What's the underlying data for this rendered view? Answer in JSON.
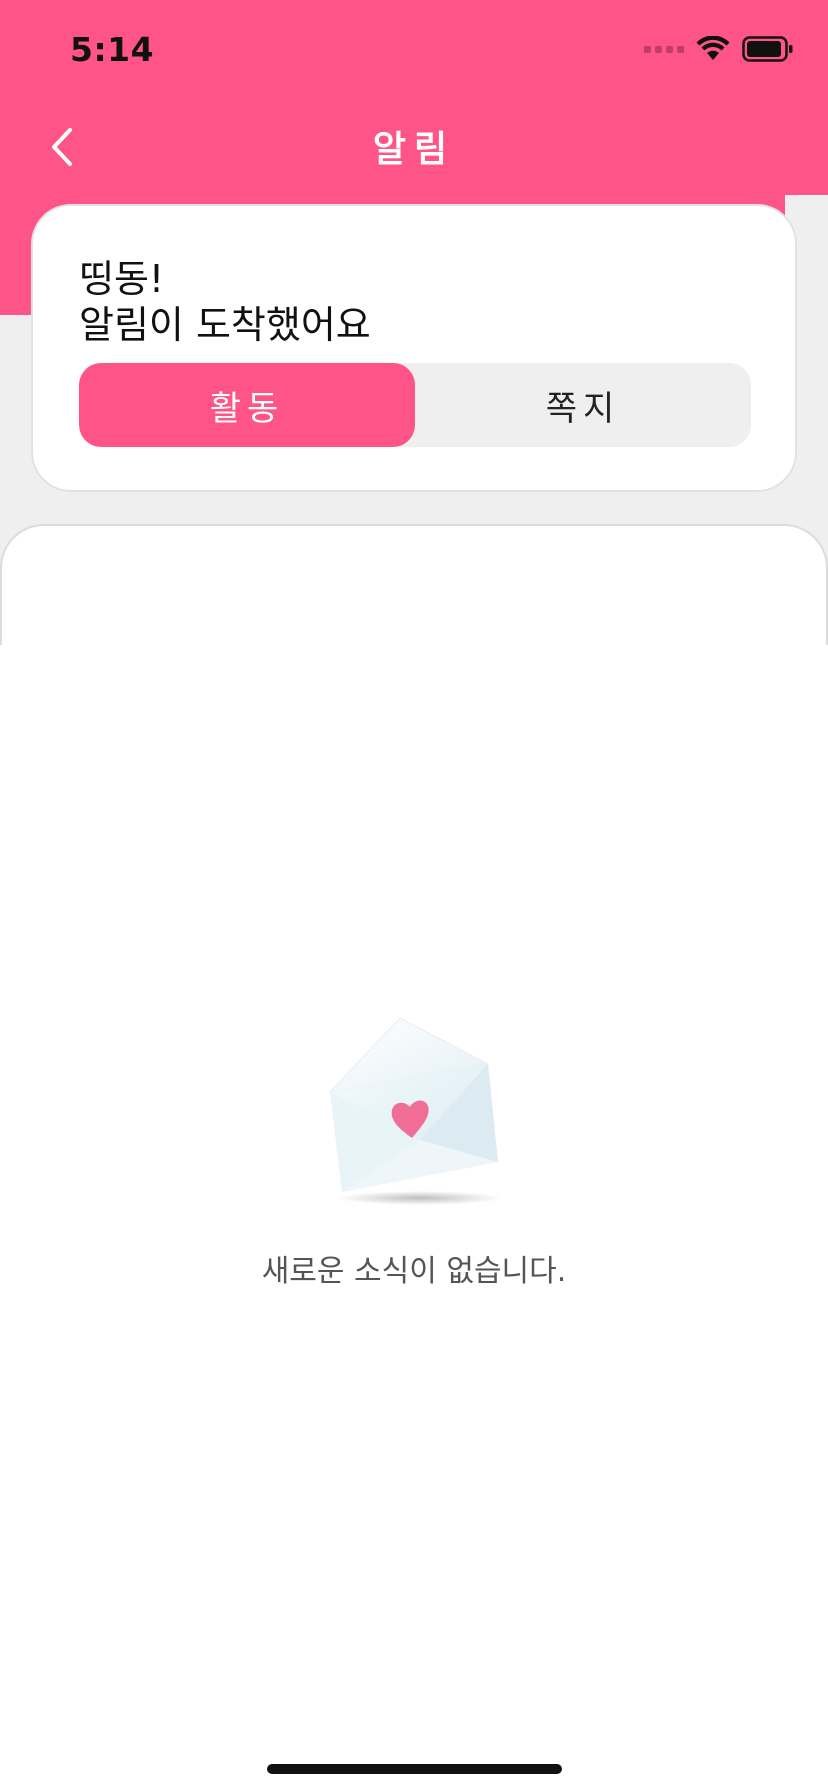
{
  "status_bar": {
    "time": "5:14"
  },
  "nav": {
    "title": "알림",
    "back_icon": "chevron-left-icon"
  },
  "greeting": {
    "line1": "띵동!",
    "line2": "알림이 도착했어요"
  },
  "tabs": [
    {
      "label": "활동",
      "active": true
    },
    {
      "label": "쪽지",
      "active": false
    }
  ],
  "empty_state": {
    "icon": "envelope-heart-icon",
    "message": "새로운 소식이 없습니다."
  },
  "colors": {
    "brand_pink": "#FF5488",
    "background_gray": "#EFEFEF"
  }
}
